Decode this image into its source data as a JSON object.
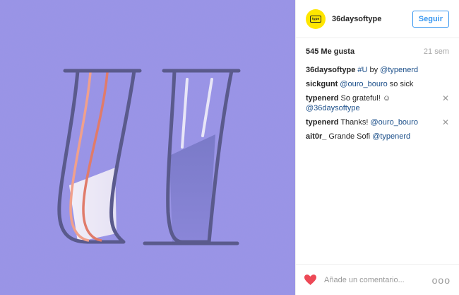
{
  "header": {
    "username": "36daysoftype",
    "follow_label": "Seguir",
    "avatar_text": "type"
  },
  "meta": {
    "likes": "545 Me gusta",
    "time": "21 sem"
  },
  "comments": [
    {
      "user": "36daysoftype",
      "parts": [
        " ",
        {
          "link": "#U"
        },
        " by ",
        {
          "link": "@typenerd"
        }
      ],
      "closable": false
    },
    {
      "user": "sickgunt",
      "parts": [
        " ",
        {
          "link": "@ouro_bouro"
        },
        " so sick"
      ],
      "closable": false
    },
    {
      "user": "typenerd",
      "parts": [
        " So grateful! ☺ ",
        {
          "link": "@36daysoftype"
        }
      ],
      "closable": true
    },
    {
      "user": "typenerd",
      "parts": [
        " Thanks! ",
        {
          "link": "@ouro_bouro"
        }
      ],
      "closable": true
    },
    {
      "user": "ait0r_",
      "parts": [
        "  Grande Sofi ",
        {
          "link": "@typenerd"
        }
      ],
      "closable": false
    }
  ],
  "footer": {
    "comment_placeholder": "Añade un comentario...",
    "more_label": "ooo"
  },
  "colors": {
    "background": "#9b96e8",
    "outline": "#5a5a8c",
    "accent": "#3897f0",
    "link": "#1b4f8a"
  },
  "icons": {
    "like": "heart-icon",
    "close": "close-icon",
    "more": "more-options-icon"
  }
}
